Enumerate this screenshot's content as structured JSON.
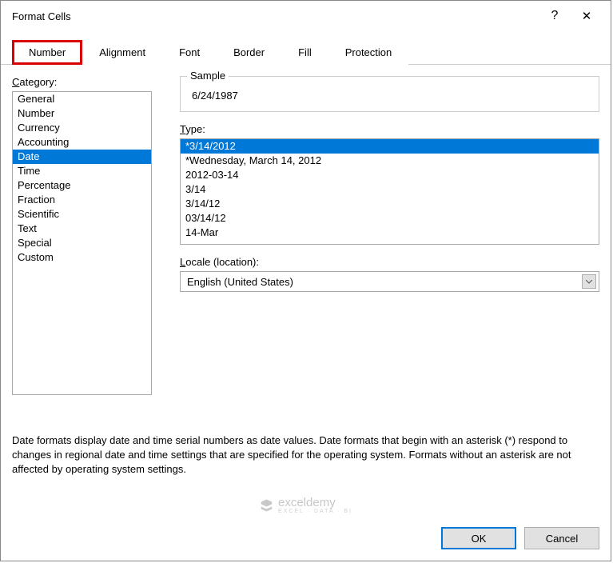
{
  "titlebar": {
    "title": "Format Cells",
    "help": "?",
    "close": "✕"
  },
  "tabs": {
    "number": "Number",
    "alignment": "Alignment",
    "font": "Font",
    "border": "Border",
    "fill": "Fill",
    "protection": "Protection"
  },
  "category": {
    "label": "Category:",
    "items": {
      "general": "General",
      "number": "Number",
      "currency": "Currency",
      "accounting": "Accounting",
      "date": "Date",
      "time": "Time",
      "percentage": "Percentage",
      "fraction": "Fraction",
      "scientific": "Scientific",
      "text": "Text",
      "special": "Special",
      "custom": "Custom"
    }
  },
  "sample": {
    "label": "Sample",
    "value": "6/24/1987"
  },
  "type": {
    "label": "Type:",
    "items": {
      "t0": "*3/14/2012",
      "t1": "*Wednesday, March 14, 2012",
      "t2": "2012-03-14",
      "t3": "3/14",
      "t4": "3/14/12",
      "t5": "03/14/12",
      "t6": "14-Mar"
    }
  },
  "locale": {
    "label": "Locale (location):",
    "value": "English (United States)"
  },
  "description": "Date formats display date and time serial numbers as date values.  Date formats that begin with an asterisk (*) respond to changes in regional date and time settings that are specified for the operating system. Formats without an asterisk are not affected by operating system settings.",
  "watermark": {
    "name": "exceldemy",
    "tagline": "EXCEL · DATA · BI"
  },
  "buttons": {
    "ok": "OK",
    "cancel": "Cancel"
  }
}
